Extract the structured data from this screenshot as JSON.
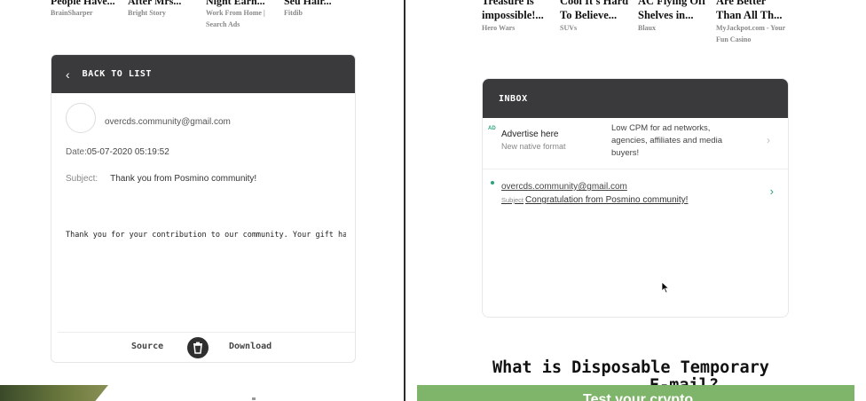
{
  "left_ads": [
    {
      "title": "People Have...",
      "source": "BrainSharper"
    },
    {
      "title": "After Mrs...",
      "source": "Bright Story"
    },
    {
      "title": "Night Earn...",
      "source": "Work From Home |",
      "source2": "Search Ads"
    },
    {
      "title": "Seu Hair...",
      "source": "Fitdib"
    }
  ],
  "right_ads": [
    {
      "title": "Treasure is\nimpossible!...",
      "source": "Hero Wars"
    },
    {
      "title": "Cool It's Hard\nTo Believe...",
      "source": "SUVs"
    },
    {
      "title": "AC Flying Off\nShelves in...",
      "source": "Blaux"
    },
    {
      "title": "Are Better\nThan All Th...",
      "source": "MyJackpot.com - Your",
      "source2": "Fun Casino"
    }
  ],
  "email_view": {
    "back_label": "BACK TO LIST",
    "sender": "overcds.community@gmail.com",
    "date_label": "Date:",
    "date_value": "05-07-2020 05:19:52",
    "subject_label": "Subject:",
    "subject_value": "Thank you from Posmino community!",
    "body": "Thank you for your contribution to our community. Your gift ha",
    "source_label": "Source",
    "download_label": "Download"
  },
  "inbox": {
    "header": "INBOX",
    "ad": {
      "badge": "AD",
      "title": "Advertise here",
      "subtitle": "New native format",
      "description": "Low CPM for ad networks, agencies, affiliates and media buyers!"
    },
    "messages": [
      {
        "from": "overcds.community@gmail.com",
        "subject_label": "Subject",
        "subject": "Congratulation from Posmino community!"
      }
    ]
  },
  "section_heading": "What is Disposable Temporary",
  "section_heading_cont": "E-mail?",
  "banner_text": "Test your crypto",
  "colors": {
    "header_bg": "#3a3a3c",
    "accent": "#2aa57a",
    "banner": "#7fb56a"
  }
}
